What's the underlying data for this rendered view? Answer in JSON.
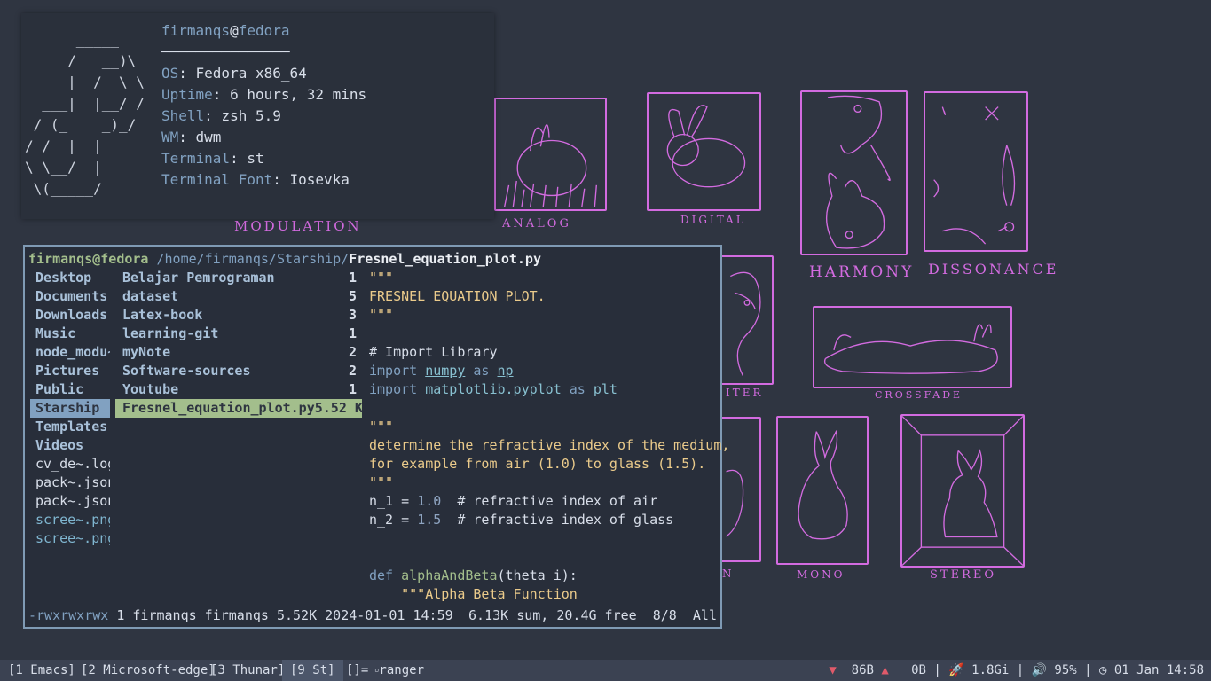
{
  "wallpaper": {
    "labels": {
      "modulation": "MODULATION",
      "analog": "ANALOG",
      "digital": "DIGITAL",
      "harmony": "HARMONY",
      "dissonance": "DISSONANCE",
      "filter": "ITER",
      "crossfade": "CROSSFADE",
      "partial": "N",
      "mono": "MONO",
      "stereo": "STEREO"
    },
    "accent_color": "#d36be0"
  },
  "fetch": {
    "ascii_lines": [
      "      _____",
      "     /   __)\\",
      "     |  /  \\ \\",
      "  ___|  |__/ /",
      " / (_    _)_/",
      "/ /  |  |",
      "\\ \\__/  |",
      " \\(_____/"
    ],
    "user": "firmanqs",
    "at": "@",
    "host": "fedora",
    "separator": "───────────────",
    "rows": [
      {
        "key": "OS",
        "value": "Fedora x86_64"
      },
      {
        "key": "Uptime",
        "value": "6 hours, 32 mins"
      },
      {
        "key": "Shell",
        "value": "zsh 5.9"
      },
      {
        "key": "WM",
        "value": "dwm"
      },
      {
        "key": "Terminal",
        "value": "st"
      },
      {
        "key": "Terminal Font",
        "value": "Iosevka"
      }
    ]
  },
  "ranger": {
    "title": {
      "host": "firmanqs@fedora",
      "path": "/home/firmanqs/Starship/",
      "file": "Fresnel_equation_plot.py"
    },
    "parent_items": [
      {
        "label": "Desktop",
        "kind": "dir"
      },
      {
        "label": "Documents",
        "kind": "dir"
      },
      {
        "label": "Downloads",
        "kind": "dir"
      },
      {
        "label": "Music",
        "kind": "dir"
      },
      {
        "label": "node_modu~",
        "kind": "dir"
      },
      {
        "label": "Pictures",
        "kind": "dir"
      },
      {
        "label": "Public",
        "kind": "dir"
      },
      {
        "label": "Starship",
        "kind": "sel"
      },
      {
        "label": "Templates",
        "kind": "dir"
      },
      {
        "label": "Videos",
        "kind": "dir"
      },
      {
        "label": "cv_de~.log",
        "kind": "file"
      },
      {
        "label": "pack~.json",
        "kind": "file"
      },
      {
        "label": "pack~.json",
        "kind": "file"
      },
      {
        "label": "scree~.png",
        "kind": "img"
      },
      {
        "label": "scree~.png",
        "kind": "img"
      }
    ],
    "current_items": [
      {
        "label": "Belajar Pemrograman",
        "info": "1",
        "kind": "dir"
      },
      {
        "label": "dataset",
        "info": "5",
        "kind": "dir"
      },
      {
        "label": "Latex-book",
        "info": "3",
        "kind": "dir"
      },
      {
        "label": "learning-git",
        "info": "1",
        "kind": "dir"
      },
      {
        "label": "myNote",
        "info": "2",
        "kind": "dir"
      },
      {
        "label": "Software-sources",
        "info": "2",
        "kind": "dir"
      },
      {
        "label": "Youtube",
        "info": "1",
        "kind": "dir"
      },
      {
        "label": "Fresnel_equation_plot.py",
        "info": "5.52 K",
        "kind": "sel"
      }
    ],
    "preview_lines": [
      [
        {
          "t": "\"\"\"",
          "c": "str"
        }
      ],
      [
        {
          "t": "FRESNEL EQUATION PLOT.",
          "c": "str"
        }
      ],
      [
        {
          "t": "\"\"\"",
          "c": "str"
        }
      ],
      [],
      [
        {
          "t": "# Import Library",
          "c": "plain"
        }
      ],
      [
        {
          "t": "import ",
          "c": "kw"
        },
        {
          "t": "numpy",
          "c": "mod"
        },
        {
          "t": " as ",
          "c": "kw"
        },
        {
          "t": "np",
          "c": "mod"
        }
      ],
      [
        {
          "t": "import ",
          "c": "kw"
        },
        {
          "t": "matplotlib.pyplot",
          "c": "mod"
        },
        {
          "t": " as ",
          "c": "kw"
        },
        {
          "t": "plt",
          "c": "mod"
        }
      ],
      [],
      [
        {
          "t": "\"\"\"",
          "c": "str"
        }
      ],
      [
        {
          "t": "determine the refractive index of the medium,",
          "c": "str"
        }
      ],
      [
        {
          "t": "for example from air (1.0) to glass (1.5).",
          "c": "str"
        }
      ],
      [
        {
          "t": "\"\"\"",
          "c": "str"
        }
      ],
      [
        {
          "t": "n_1 = ",
          "c": "plain"
        },
        {
          "t": "1.0",
          "c": "num"
        },
        {
          "t": "  # refractive index of air",
          "c": "plain"
        }
      ],
      [
        {
          "t": "n_2 = ",
          "c": "plain"
        },
        {
          "t": "1.5",
          "c": "num"
        },
        {
          "t": "  # refractive index of glass",
          "c": "plain"
        }
      ],
      [],
      [],
      [
        {
          "t": "def ",
          "c": "kw"
        },
        {
          "t": "alphaAndBeta",
          "c": "fn"
        },
        {
          "t": "(theta_i):",
          "c": "plain"
        }
      ],
      [
        {
          "t": "    \"\"\"Alpha Beta Function",
          "c": "str"
        }
      ]
    ],
    "status": {
      "perm": "-rwxrwxrwx",
      "info": " 1 firmanqs firmanqs 5.52K 2024-01-01 14:59",
      "right": "6.13K sum, 20.4G free  8/8  All"
    }
  },
  "bar": {
    "tags": [
      {
        "label": "[1 Emacs]",
        "active": false
      },
      {
        "label": "[2 Microsoft-edge]",
        "active": false
      },
      {
        "label": "[3 Thunar]",
        "active": false
      },
      {
        "label": "[9 St]",
        "active": true
      }
    ],
    "layout": "[]=",
    "window_title": "ranger",
    "status": {
      "down": "▼",
      "down_value": "  86B ",
      "up": "▲",
      "up_value": "   0B | 🚀 1.8Gi | 🔊 95% | ◷ 01 Jan 14:58"
    }
  }
}
